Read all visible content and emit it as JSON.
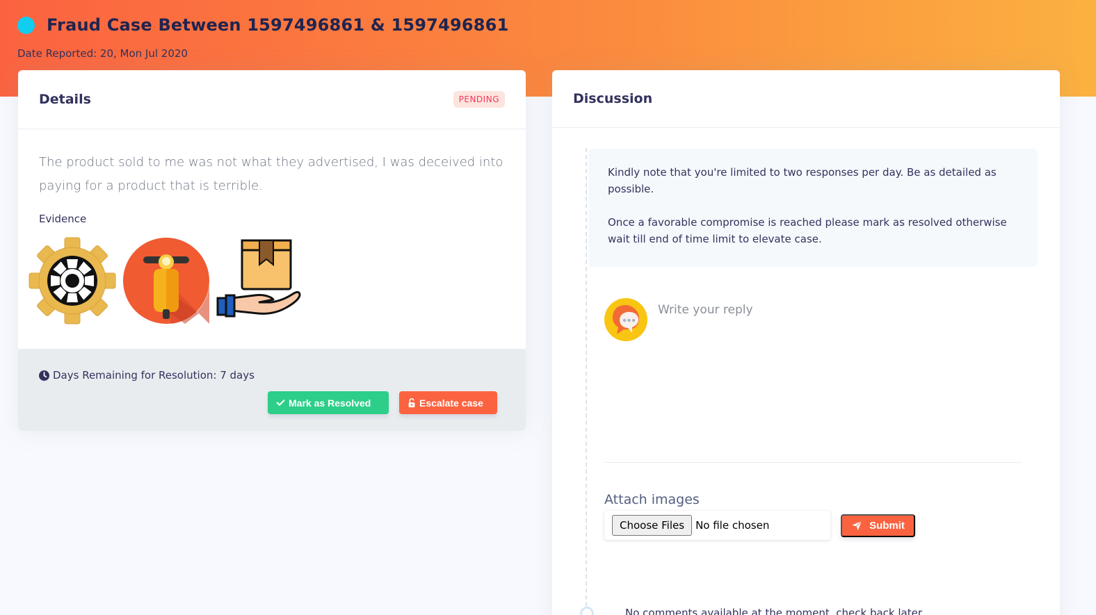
{
  "case": {
    "title": "Fraud Case Between 1597496861 & 1597496861",
    "date_reported": "Date Reported: 20, Mon Jul 2020",
    "status_dot_color": "#11cdef"
  },
  "details": {
    "title": "Details",
    "status": "PENDING",
    "complaint": "The product sold to me was not what they advertised, I was deceived into paying for a product that is terrible.",
    "evidence_label": "Evidence",
    "evidence_images": [
      "gear-image",
      "scooter-image",
      "package-delivery-image"
    ],
    "days_remaining": "Days Remaining for Resolution: 7 days",
    "resolve_label": "Mark as Resolved",
    "escalate_label": "Escalate case"
  },
  "discussion": {
    "title": "Discussion",
    "note_line1": "Kindly note that you're limited to two responses per day. Be as detailed as possible.",
    "note_line2": "Once a favorable compromise is reached please mark as resolved otherwise wait till end of time limit to elevate case.",
    "reply_placeholder": "Write your reply",
    "attach_label": "Attach images",
    "choose_files_label": "Choose Files",
    "no_file_label": "No file chosen",
    "submit_label": "Submit",
    "no_comments": "No comments available at the moment, check back later"
  },
  "colors": {
    "header_start": "#fb6340",
    "header_end": "#fbb140",
    "success": "#2dce89",
    "danger": "#fb6340",
    "badge_bg": "#fde4de"
  }
}
